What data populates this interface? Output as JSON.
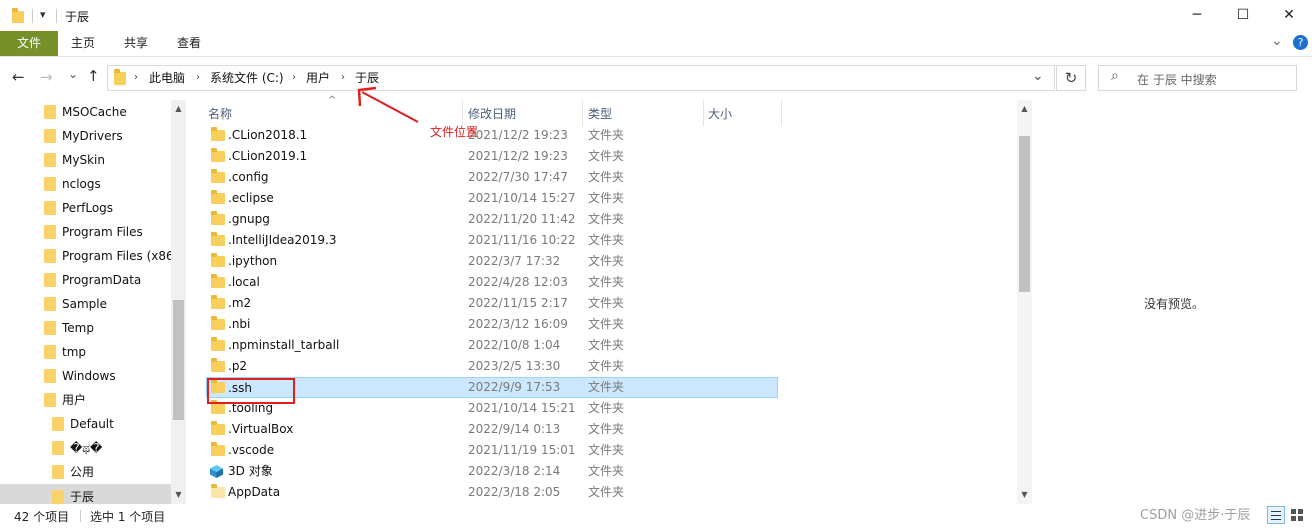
{
  "titlebar": {
    "title": "于辰",
    "minimize": "─",
    "maximize": "☐",
    "close": "✕",
    "quick_access_arrow": "▾"
  },
  "ribbon": {
    "tabs": [
      "文件",
      "主页",
      "共享",
      "查看"
    ],
    "expand_chevron": "⌄",
    "help": "?"
  },
  "navigation": {
    "back": "←",
    "forward": "→",
    "recent": "⌄",
    "up": "↑",
    "breadcrumbs": [
      "此电脑",
      "系统文件 (C:)",
      "用户",
      "于辰"
    ],
    "dropdown": "⌄",
    "refresh": "↻",
    "search_placeholder": "在 于辰 中搜索"
  },
  "sidebar": {
    "items": [
      {
        "label": "MSOCache",
        "level": 0
      },
      {
        "label": "MyDrivers",
        "level": 0
      },
      {
        "label": "MySkin",
        "level": 0
      },
      {
        "label": "nclogs",
        "level": 0
      },
      {
        "label": "PerfLogs",
        "level": 0
      },
      {
        "label": "Program Files",
        "level": 0
      },
      {
        "label": "Program Files (x86",
        "level": 0
      },
      {
        "label": "ProgramData",
        "level": 0
      },
      {
        "label": "Sample",
        "level": 0
      },
      {
        "label": "Temp",
        "level": 0
      },
      {
        "label": "tmp",
        "level": 0
      },
      {
        "label": "Windows",
        "level": 0
      },
      {
        "label": "用户",
        "level": 0
      },
      {
        "label": "Default",
        "level": 1
      },
      {
        "label": "�ಥ�",
        "level": 1
      },
      {
        "label": "公用",
        "level": 1
      },
      {
        "label": "于辰",
        "level": 1,
        "selected": true
      }
    ]
  },
  "file_list": {
    "columns": [
      "名称",
      "修改日期",
      "类型",
      "大小"
    ],
    "sort_indicator": "^",
    "rows": [
      {
        "name": ".CLion2018.1",
        "date": "2021/12/2 19:23",
        "type": "文件夹"
      },
      {
        "name": ".CLion2019.1",
        "date": "2021/12/2 19:23",
        "type": "文件夹"
      },
      {
        "name": ".config",
        "date": "2022/7/30 17:47",
        "type": "文件夹"
      },
      {
        "name": ".eclipse",
        "date": "2021/10/14 15:27",
        "type": "文件夹"
      },
      {
        "name": ".gnupg",
        "date": "2022/11/20 11:42",
        "type": "文件夹"
      },
      {
        "name": ".IntelliJIdea2019.3",
        "date": "2021/11/16 10:22",
        "type": "文件夹"
      },
      {
        "name": ".ipython",
        "date": "2022/3/7 17:32",
        "type": "文件夹"
      },
      {
        "name": ".local",
        "date": "2022/4/28 12:03",
        "type": "文件夹"
      },
      {
        "name": ".m2",
        "date": "2022/11/15 2:17",
        "type": "文件夹"
      },
      {
        "name": ".nbi",
        "date": "2022/3/12 16:09",
        "type": "文件夹"
      },
      {
        "name": ".npminstall_tarball",
        "date": "2022/10/8 1:04",
        "type": "文件夹"
      },
      {
        "name": ".p2",
        "date": "2023/2/5 13:30",
        "type": "文件夹"
      },
      {
        "name": ".ssh",
        "date": "2022/9/9 17:53",
        "type": "文件夹",
        "selected": true
      },
      {
        "name": ".tooling",
        "date": "2021/10/14 15:21",
        "type": "文件夹"
      },
      {
        "name": ".VirtualBox",
        "date": "2022/9/14 0:13",
        "type": "文件夹"
      },
      {
        "name": ".vscode",
        "date": "2021/11/19 15:01",
        "type": "文件夹"
      },
      {
        "name": "3D 对象",
        "date": "2022/3/18 2:14",
        "type": "文件夹",
        "icon": "3d-objects-icon"
      },
      {
        "name": "AppData",
        "date": "2022/3/18 2:05",
        "type": "文件夹",
        "icon": "folder-light-icon"
      }
    ]
  },
  "annotation": {
    "label": "文件位置",
    "color": "#e02020"
  },
  "preview": {
    "text": "没有预览。"
  },
  "status": {
    "count": "42 个项目",
    "selected": "选中 1 个项目",
    "watermark": "CSDN @进步·于辰"
  },
  "colors": {
    "ribbon_file_tab": "#78902a",
    "selection": "#cce8ff",
    "selection_border": "#99d1ff",
    "folder": "#f7cf5a",
    "annotation_red": "#e02020"
  }
}
